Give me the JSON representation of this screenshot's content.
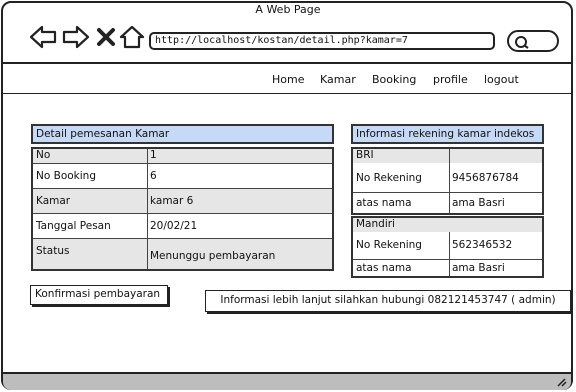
{
  "window": {
    "title": "A Web Page"
  },
  "browser": {
    "url": "http://localhost/kostan/detail.php?kamar=7"
  },
  "nav": {
    "items": [
      {
        "label": "Home"
      },
      {
        "label": "Kamar"
      },
      {
        "label": "Booking"
      },
      {
        "label": "profile"
      },
      {
        "label": "logout"
      }
    ]
  },
  "booking": {
    "title": "Detail pemesanan Kamar",
    "rows": [
      {
        "label": "No",
        "value": "1"
      },
      {
        "label": "No Booking",
        "value": "6"
      },
      {
        "label": "Kamar",
        "value": "kamar 6"
      },
      {
        "label": "Tanggal Pesan",
        "value": "20/02/21"
      },
      {
        "label": "Status",
        "value": "Menunggu pembayaran"
      }
    ]
  },
  "rekening": {
    "title": "Informasi rekening kamar indekos",
    "banks": [
      {
        "name": "BRI",
        "account_label": "No Rekening",
        "account_number": "9456876784",
        "holder_label": "atas nama",
        "holder_name": "ama Basri"
      },
      {
        "name": "Mandiri",
        "account_label": "No Rekening",
        "account_number": "562346532",
        "holder_label": "atas nama",
        "holder_name": "ama Basri"
      }
    ]
  },
  "actions": {
    "confirm_label": "Konfirmasi pembayaran"
  },
  "footer_info": {
    "text": "Informasi lebih lanjut silahkan hubungi 082121453747 ( admin)"
  },
  "icons": {
    "back": "left-arrow-icon",
    "forward": "right-arrow-icon",
    "stop": "close-icon",
    "home": "home-icon",
    "search": "search-icon",
    "resize": "resize-grip-icon"
  }
}
